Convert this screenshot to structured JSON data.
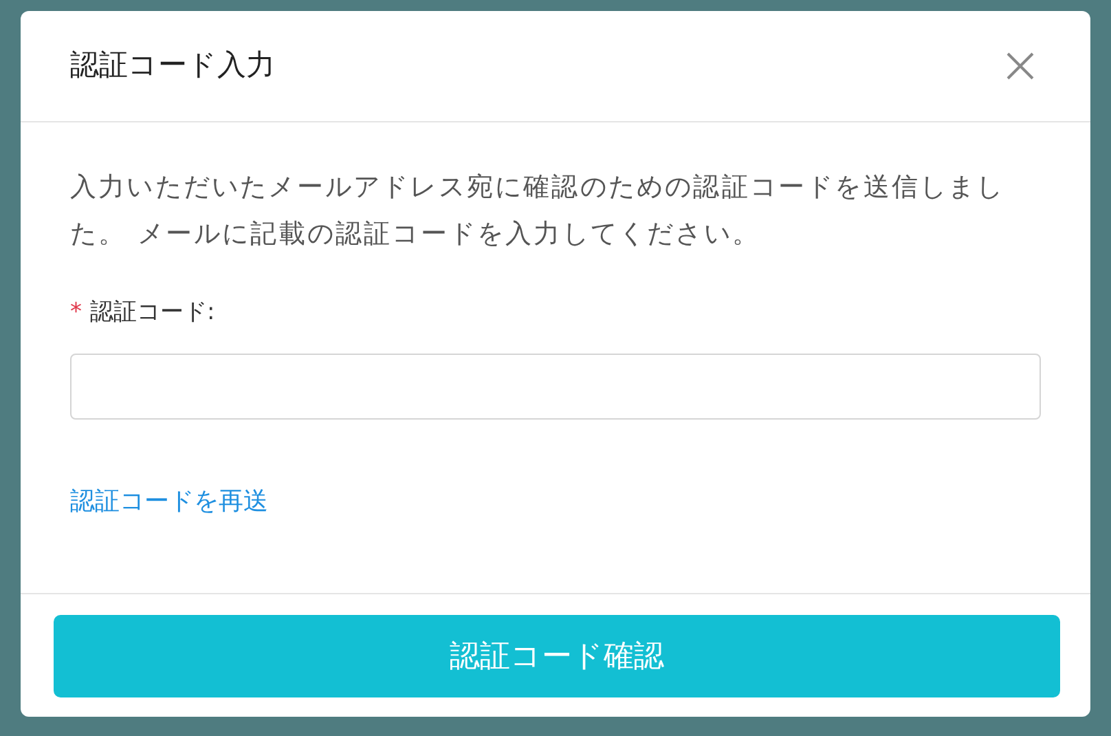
{
  "dialog": {
    "title": "認証コード入力",
    "message": "入力いただいたメールアドレス宛に確認のための認証コードを送信しました。 メールに記載の認証コードを入力してください。",
    "field": {
      "required_mark": "*",
      "label": "認証コード:"
    },
    "resend_link": "認証コードを再送",
    "submit_button": "認証コード確認"
  }
}
